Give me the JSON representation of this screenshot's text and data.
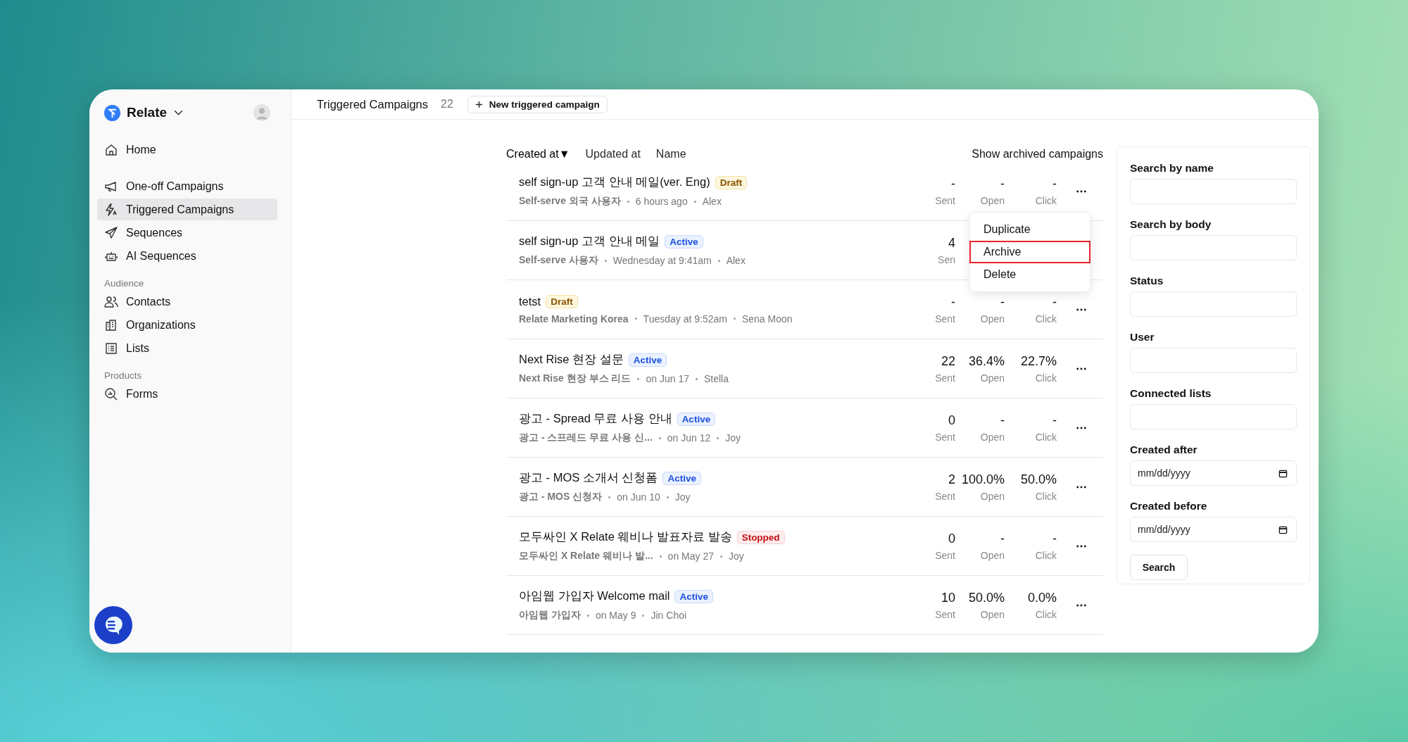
{
  "sidebar": {
    "workspace": "Relate",
    "items": [
      {
        "kind": "link",
        "label": "Home",
        "selected": false
      },
      {
        "kind": "spacer"
      },
      {
        "kind": "link",
        "label": "One-off Campaigns",
        "selected": false
      },
      {
        "kind": "link",
        "label": "Triggered Campaigns",
        "selected": true
      },
      {
        "kind": "link",
        "label": "Sequences",
        "selected": false
      },
      {
        "kind": "link",
        "label": "AI Sequences",
        "selected": false
      },
      {
        "kind": "header",
        "label": "Audience"
      },
      {
        "kind": "link",
        "label": "Contacts",
        "selected": false
      },
      {
        "kind": "link",
        "label": "Organizations",
        "selected": false
      },
      {
        "kind": "link",
        "label": "Lists",
        "selected": false
      },
      {
        "kind": "header",
        "label": "Products"
      },
      {
        "kind": "link",
        "label": "Forms",
        "selected": false
      }
    ]
  },
  "topbar": {
    "title": "Triggered Campaigns",
    "count": "22",
    "new_button": "New triggered campaign"
  },
  "sort_indicator": "▼",
  "sort_options": [
    {
      "label": "Created at",
      "selected": true
    },
    {
      "label": "Updated at",
      "selected": false
    },
    {
      "label": "Name",
      "selected": false
    }
  ],
  "show_archived": "Show archived campaigns",
  "campaigns": [
    {
      "name": "self sign-up 고객 안내 메일(ver. Eng)",
      "status": {
        "kind": "draft",
        "label": "Draft"
      },
      "audience": "Self-serve 외국 사용자",
      "date": "6 hours ago",
      "author": "Alex",
      "stats": [
        {
          "value": "-",
          "label": "Sent"
        },
        {
          "value": "-",
          "label": "Open"
        },
        {
          "value": "-",
          "label": "Click"
        }
      ]
    },
    {
      "name": "self sign-up 고객 안내 메일",
      "status": {
        "kind": "active",
        "label": "Active"
      },
      "audience": "Self-serve 사용자",
      "date": "Wednesday at 9:41am",
      "author": "Alex",
      "stats": [
        {
          "value": "4",
          "label": "Sen"
        }
      ]
    },
    {
      "name": "tetst",
      "status": {
        "kind": "draft",
        "label": "Draft"
      },
      "audience": "Relate Marketing Korea",
      "date": "Tuesday at 9:52am",
      "author": "Sena Moon",
      "stats": [
        {
          "value": "-",
          "label": "Sent"
        },
        {
          "value": "-",
          "label": "Open"
        },
        {
          "value": "-",
          "label": "Click"
        }
      ]
    },
    {
      "name": "Next Rise 현장 설문",
      "status": {
        "kind": "active",
        "label": "Active"
      },
      "audience": "Next Rise 현장 부스 리드",
      "date": "on Jun 17",
      "author": "Stella",
      "stats": [
        {
          "value": "22",
          "label": "Sent"
        },
        {
          "value": "36.4%",
          "label": "Open"
        },
        {
          "value": "22.7%",
          "label": "Click"
        }
      ]
    },
    {
      "name": "광고 - Spread 무료 사용 안내",
      "status": {
        "kind": "active",
        "label": "Active"
      },
      "audience": "광고 - 스프레드 무료 사용 신...",
      "date": "on Jun 12",
      "author": "Joy",
      "stats": [
        {
          "value": "0",
          "label": "Sent"
        },
        {
          "value": "-",
          "label": "Open"
        },
        {
          "value": "-",
          "label": "Click"
        }
      ]
    },
    {
      "name": "광고 - MOS 소개서 신청폼",
      "status": {
        "kind": "active",
        "label": "Active"
      },
      "audience": "광고 - MOS 신청자",
      "date": "on Jun 10",
      "author": "Joy",
      "stats": [
        {
          "value": "2",
          "label": "Sent"
        },
        {
          "value": "100.0%",
          "label": "Open"
        },
        {
          "value": "50.0%",
          "label": "Click"
        }
      ]
    },
    {
      "name": "모두싸인 X Relate 웨비나 발표자료 발송",
      "status": {
        "kind": "stopped",
        "label": "Stopped"
      },
      "audience": "모두싸인 X Relate 웨비나 발...",
      "date": "on May 27",
      "author": "Joy",
      "stats": [
        {
          "value": "0",
          "label": "Sent"
        },
        {
          "value": "-",
          "label": "Open"
        },
        {
          "value": "-",
          "label": "Click"
        }
      ]
    },
    {
      "name": "아임웹 가입자 Welcome mail",
      "status": {
        "kind": "active",
        "label": "Active"
      },
      "audience": "아임웹 가입자",
      "date": "on May 9",
      "author": "Jin Choi",
      "stats": [
        {
          "value": "10",
          "label": "Sent"
        },
        {
          "value": "50.0%",
          "label": "Open"
        },
        {
          "value": "0.0%",
          "label": "Click"
        }
      ]
    }
  ],
  "row_menu": {
    "items": [
      {
        "label": "Duplicate",
        "highlighted": false
      },
      {
        "label": "Archive",
        "highlighted": true
      },
      {
        "label": "Delete",
        "highlighted": false
      }
    ]
  },
  "filters": {
    "fields": [
      {
        "kind": "text",
        "label": "Search by name"
      },
      {
        "kind": "text",
        "label": "Search by body"
      },
      {
        "kind": "text",
        "label": "Status"
      },
      {
        "kind": "text",
        "label": "User"
      },
      {
        "kind": "text",
        "label": "Connected lists"
      },
      {
        "kind": "date",
        "label": "Created after",
        "placeholder": "mm/dd/yyyy"
      },
      {
        "kind": "date",
        "label": "Created before",
        "placeholder": "mm/dd/yyyy"
      }
    ],
    "button": "Search"
  }
}
